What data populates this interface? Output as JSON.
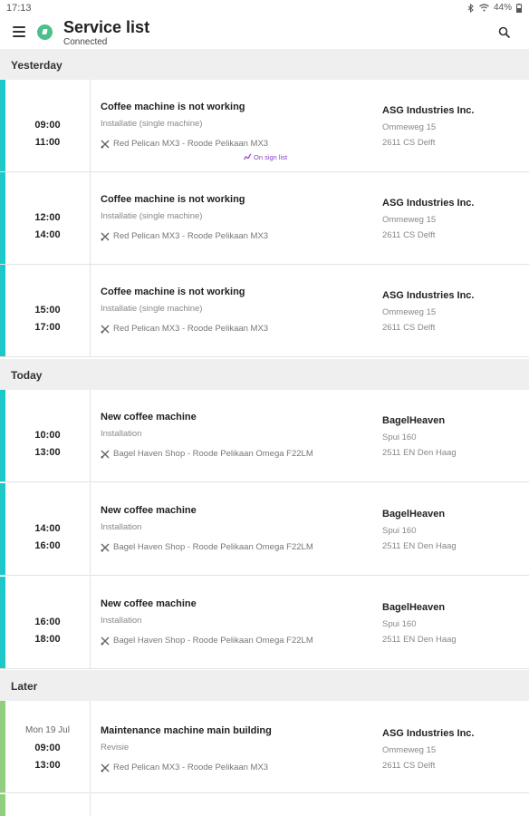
{
  "statusbar": {
    "time": "17:13",
    "battery": "44%"
  },
  "appbar": {
    "title": "Service list",
    "subtitle": "Connected"
  },
  "sections": {
    "yesterday": "Yesterday",
    "today": "Today",
    "later": "Later"
  },
  "rows": [
    {
      "start": "09:00",
      "end": "11:00",
      "title": "Coffee machine is not working",
      "type": "Installatie (single machine)",
      "machine": "Red Pelican MX3 - Roode Pelikaan MX3",
      "sign_list": "On sign list",
      "company": "ASG Industries Inc.",
      "street": "Ommeweg 15",
      "city": "2611 CS Delft"
    },
    {
      "start": "12:00",
      "end": "14:00",
      "title": "Coffee machine is not working",
      "type": "Installatie (single machine)",
      "machine": "Red Pelican MX3 - Roode Pelikaan MX3",
      "company": "ASG Industries Inc.",
      "street": "Ommeweg 15",
      "city": "2611 CS Delft"
    },
    {
      "start": "15:00",
      "end": "17:00",
      "title": "Coffee machine is not working",
      "type": "Installatie (single machine)",
      "machine": "Red Pelican MX3 - Roode Pelikaan MX3",
      "company": "ASG Industries Inc.",
      "street": "Ommeweg 15",
      "city": "2611 CS Delft"
    },
    {
      "start": "10:00",
      "end": "13:00",
      "title": "New coffee machine",
      "type": "Installation",
      "machine": "Bagel Haven Shop - Roode Pelikaan Omega F22LM",
      "company": "BagelHeaven",
      "street": "Spui 160",
      "city": "2511 EN Den Haag"
    },
    {
      "start": "14:00",
      "end": "16:00",
      "title": "New coffee machine",
      "type": "Installation",
      "machine": "Bagel Haven Shop - Roode Pelikaan Omega F22LM",
      "company": "BagelHeaven",
      "street": "Spui 160",
      "city": "2511 EN Den Haag"
    },
    {
      "start": "16:00",
      "end": "18:00",
      "title": "New coffee machine",
      "type": "Installation",
      "machine": "Bagel Haven Shop - Roode Pelikaan Omega F22LM",
      "company": "BagelHeaven",
      "street": "Spui 160",
      "city": "2511 EN Den Haag"
    },
    {
      "date": "Mon 19 Jul",
      "start": "09:00",
      "end": "13:00",
      "title": "Maintenance machine main building",
      "type": "Revisie",
      "machine": "Red Pelican MX3 - Roode Pelikaan MX3",
      "company": "ASG Industries Inc.",
      "street": "Ommeweg 15",
      "city": "2611 CS Delft"
    }
  ],
  "icons": {
    "menu": "menu-icon",
    "status": "connected-icon",
    "search": "search-icon",
    "tool": "wrench-screwdriver-icon",
    "sign": "signature-icon"
  },
  "colors": {
    "accent_current": "#1ec8c8",
    "accent_later": "#8fcf7e",
    "status_green": "#4cbf8c",
    "sign_purple": "#8a3fc7"
  }
}
